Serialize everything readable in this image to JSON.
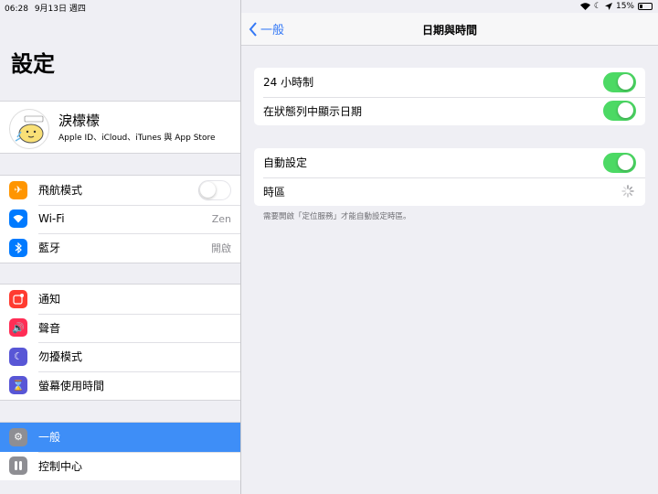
{
  "status_bar": {
    "time": "06:28",
    "date": "9月13日 週四",
    "battery": "15%"
  },
  "sidebar": {
    "title": "設定",
    "profile": {
      "name": "淚檬檬",
      "subtitle": "Apple ID、iCloud、iTunes 與 App Store"
    },
    "group1": [
      {
        "label": "飛航模式",
        "icon": "airplane-icon",
        "color": "#ff9500",
        "toggle": false
      },
      {
        "label": "Wi-Fi",
        "icon": "wifi-icon",
        "color": "#007aff",
        "value": "Zen"
      },
      {
        "label": "藍牙",
        "icon": "bluetooth-icon",
        "color": "#007aff",
        "value": "開啟"
      }
    ],
    "group2": [
      {
        "label": "通知",
        "icon": "notifications-icon",
        "color": "#ff3b30"
      },
      {
        "label": "聲音",
        "icon": "sound-icon",
        "color": "#ff2d55"
      },
      {
        "label": "勿擾模式",
        "icon": "moon-icon",
        "color": "#5856d6"
      },
      {
        "label": "螢幕使用時間",
        "icon": "hourglass-icon",
        "color": "#5856d6"
      }
    ],
    "group3": [
      {
        "label": "一般",
        "icon": "gear-icon",
        "color": "#8e8e93",
        "selected": true
      },
      {
        "label": "控制中心",
        "icon": "control-center-icon",
        "color": "#8e8e93"
      }
    ]
  },
  "detail": {
    "back_label": "一般",
    "title": "日期與時間",
    "group1": [
      {
        "label": "24 小時制",
        "toggle": true
      },
      {
        "label": "在狀態列中顯示日期",
        "toggle": true
      }
    ],
    "group2": [
      {
        "label": "自動設定",
        "toggle": true
      },
      {
        "label": "時區"
      }
    ],
    "footnote": "需要開啟「定位服務」才能自動設定時區。"
  }
}
